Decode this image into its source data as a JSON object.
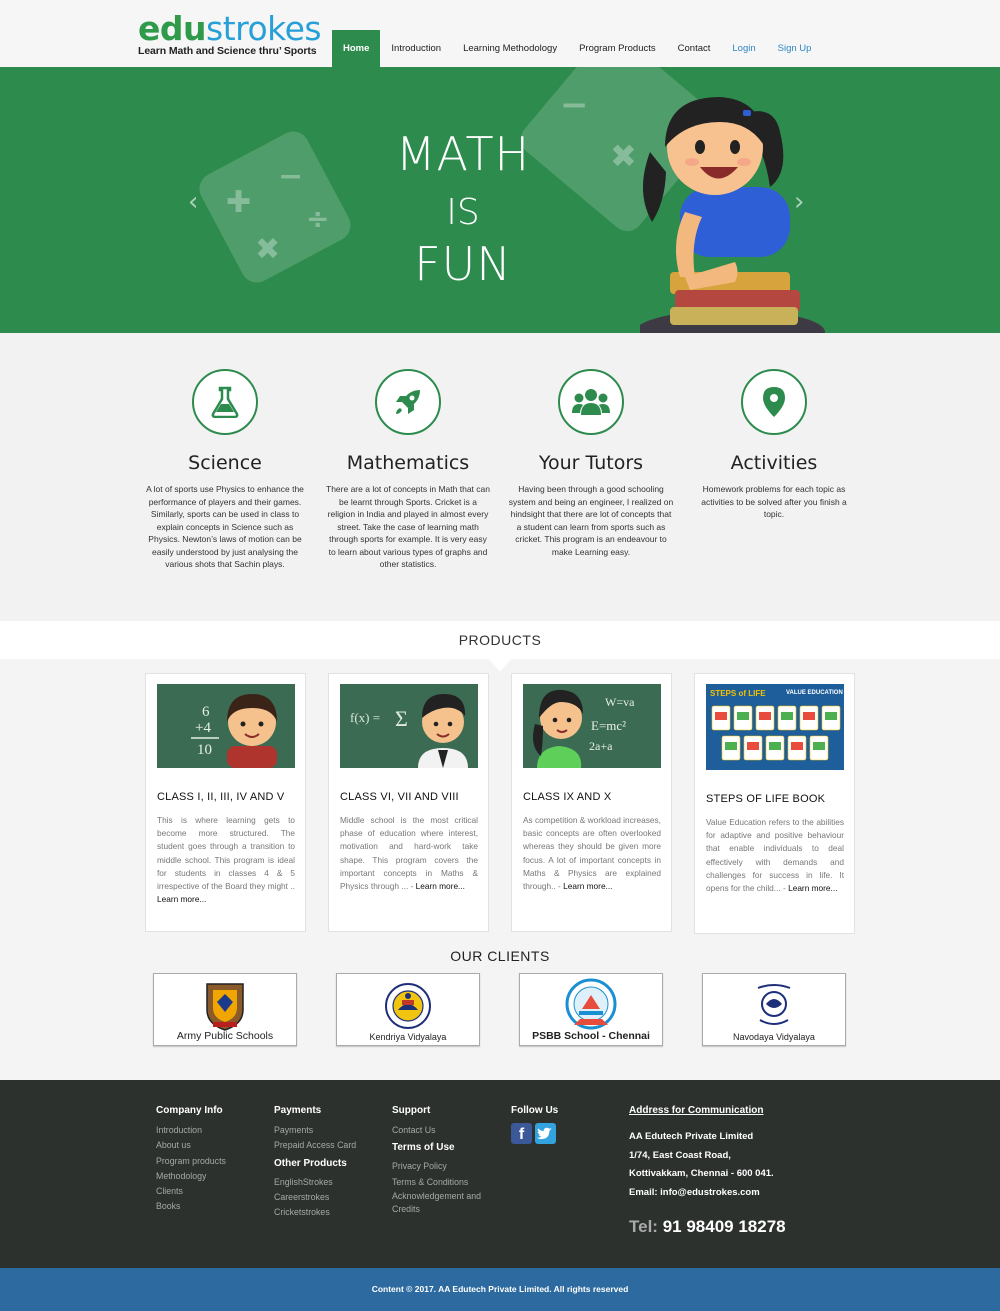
{
  "brand": {
    "logo_edu": "edu",
    "logo_strokes": "strokes",
    "tagline": "Learn Math and Science thru’ Sports"
  },
  "nav": [
    "Home",
    "Introduction",
    "Learning Methodology",
    "Program Products",
    "Contact",
    "Login",
    "Sign Up"
  ],
  "hero": {
    "line1": "MATH",
    "line2": "IS",
    "line3": "FUN",
    "prev": "‹",
    "next": "›"
  },
  "features": [
    {
      "title": "Science",
      "icon": "flask-icon",
      "text": "A lot of sports use Physics to enhance the performance of players and their games. Similarly, sports can be used in class to explain concepts in Science such as Physics. Newton’s laws of motion can be easily understood by just analysing the various shots that Sachin plays."
    },
    {
      "title": "Mathematics",
      "icon": "rocket-icon",
      "text": "There are a lot of concepts in Math that can be learnt through Sports. Cricket is a religion in India and played in almost every street. Take the case of learning math through sports for example. It is very easy to learn about various types of graphs and other statistics."
    },
    {
      "title": "Your Tutors",
      "icon": "group-icon",
      "text": "Having been through a good schooling system and being an engineer, I realized on hindsight that there are lot of concepts that a student can learn from sports such as cricket. This program is an endeavour to make Learning easy."
    },
    {
      "title": "Activities",
      "icon": "map-pin-icon",
      "text": "Homework problems for each topic as activities to be solved after you finish a topic."
    }
  ],
  "products_heading": "PRODUCTS",
  "products": [
    {
      "title": "CLASS I, II, III, IV AND V",
      "text": "This is where learning gets to become more structured. The student goes through a transition to middle school. This program is ideal for students in classes 4 & 5 irrespective of the Board they might .. ",
      "more": "Learn more..."
    },
    {
      "title": "CLASS VI, VII AND VIII",
      "text": "Middle school is the most critical phase of education where interest, motivation and hard-work take shape. This program covers the important concepts in Maths & Physics through ...  - ",
      "more": "Learn more..."
    },
    {
      "title": "CLASS IX AND X",
      "text": "As competition & workload increases, basic concepts are often overlooked whereas they should be given more focus. A lot of important concepts in Maths & Physics are explained through.. - ",
      "more": "Learn more..."
    },
    {
      "title": "STEPS OF LIFE BOOK",
      "text": "Value Education refers to the abilities for adaptive and positive behaviour that enable individuals to deal effectively with demands and challenges for success in life. It opens for the child...  - ",
      "more": "Learn more...",
      "book_title": "STEPS of LIFE",
      "book_sub": "VALUE EDUCATION"
    }
  ],
  "chalk": {
    "c1": [
      "6",
      "+4",
      "10"
    ],
    "c2": [
      "f(x) =",
      "Σ"
    ],
    "c3": [
      "W=va",
      "E=mc²",
      "2a+a"
    ]
  },
  "clients_heading": "OUR CLIENTS",
  "clients": [
    "Army Public Schools",
    "Kendriya Vidyalaya",
    "PSBB School - Chennai",
    "Navodaya Vidyalaya"
  ],
  "footer": {
    "company": {
      "heading": "Company Info",
      "links": [
        "Introduction",
        "About us",
        "Program products",
        "Methodology",
        "Clients",
        "Books"
      ]
    },
    "payments": {
      "heading": "Payments",
      "links": [
        "Payments",
        "Prepaid Access Card"
      ],
      "sub": "Other Products",
      "sub_links": [
        "EnglishStrokes",
        "Careerstrokes",
        "Cricketstrokes"
      ]
    },
    "support": {
      "heading": "Support",
      "links": [
        "Contact Us"
      ],
      "sub": "Terms of Use",
      "sub_links": [
        "Privacy Policy",
        "Terms & Conditions",
        "Acknowledgement and Credits"
      ]
    },
    "follow": {
      "heading": "Follow Us"
    },
    "address": {
      "heading": "Address for Communication",
      "lines": [
        "AA Edutech Private Limited",
        "1/74, East Coast Road,",
        "Kottivakkam, Chennai - 600 041.",
        "Email: info@edustrokes.com"
      ]
    },
    "tel_label": "Tel:",
    "tel_number": "91 98409 18278"
  },
  "copyright": "Content © 2017. AA Edutech Private Limited. All rights reserved",
  "colors": {
    "green": "#2e8b4e",
    "blue": "#27a0d8",
    "footer": "#2d312e",
    "copy_bar": "#2d6a9f"
  }
}
